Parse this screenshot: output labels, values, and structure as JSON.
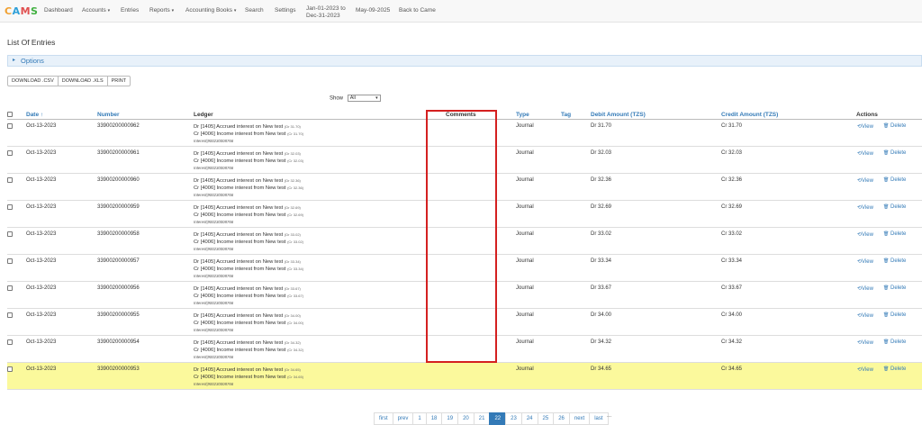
{
  "nav": {
    "logo": [
      "C",
      "A",
      "M",
      "S"
    ],
    "dashboard": "Dashboard",
    "accounts": "Accounts",
    "entries": "Entries",
    "reports": "Reports",
    "accounting_books": "Accounting Books",
    "search": "Search",
    "settings": "Settings",
    "period_line1": "Jan-01-2023 to",
    "period_line2": "Dec-31-2023",
    "date": "May-09-2025",
    "back": "Back to Came",
    "caret": "▾"
  },
  "page_title": "List Of Entries",
  "options": {
    "arrow": "▸",
    "label": "Options"
  },
  "buttons": {
    "csv": "DOWNLOAD .CSV",
    "xls": "DOWNLOAD .XLS",
    "print": "PRINT"
  },
  "show": {
    "label": "Show",
    "value": "All",
    "arrow": "▾"
  },
  "columns": {
    "date": "Date ↑",
    "number": "Number",
    "ledger": "Ledger",
    "comments": "Comments",
    "type": "Type",
    "tag": "Tag",
    "debit": "Debit Amount (TZS)",
    "credit": "Credit Amount (TZS)",
    "actions": "Actions"
  },
  "actions": {
    "view": "View",
    "delete": "Delete",
    "view_icon": "⟲",
    "delete_icon": "🗑"
  },
  "rows": [
    {
      "date": "Oct-13-2023",
      "number": "33900200000962",
      "dr_line": "Dr [1405] Accrued interest on New test",
      "dr_amt": "(Dr 31.70)",
      "cr_line": "Cr [4006] Income interest from New test",
      "cr_amt": "(Cr 31.70)",
      "narration": "Interest|900230008766",
      "type": "Journal",
      "debit": "Dr 31.70",
      "credit": "Cr 31.70"
    },
    {
      "date": "Oct-13-2023",
      "number": "33900200000961",
      "dr_line": "Dr [1405] Accrued interest on New test",
      "dr_amt": "(Dr 32.03)",
      "cr_line": "Cr [4006] Income interest from New test",
      "cr_amt": "(Cr 32.03)",
      "narration": "Interest|900230008766",
      "type": "Journal",
      "debit": "Dr 32.03",
      "credit": "Cr 32.03"
    },
    {
      "date": "Oct-13-2023",
      "number": "33900200000960",
      "dr_line": "Dr [1405] Accrued interest on New test",
      "dr_amt": "(Dr 32.36)",
      "cr_line": "Cr [4006] Income interest from New test",
      "cr_amt": "(Cr 32.36)",
      "narration": "Interest|900230008766",
      "type": "Journal",
      "debit": "Dr 32.36",
      "credit": "Cr 32.36"
    },
    {
      "date": "Oct-13-2023",
      "number": "33900200000959",
      "dr_line": "Dr [1405] Accrued interest on New test",
      "dr_amt": "(Dr 32.69)",
      "cr_line": "Cr [4006] Income interest from New test",
      "cr_amt": "(Cr 32.69)",
      "narration": "Interest|900230008766",
      "type": "Journal",
      "debit": "Dr 32.69",
      "credit": "Cr 32.69"
    },
    {
      "date": "Oct-13-2023",
      "number": "33900200000958",
      "dr_line": "Dr [1405] Accrued interest on New test",
      "dr_amt": "(Dr 33.02)",
      "cr_line": "Cr [4006] Income interest from New test",
      "cr_amt": "(Cr 33.02)",
      "narration": "Interest|900230008766",
      "type": "Journal",
      "debit": "Dr 33.02",
      "credit": "Cr 33.02"
    },
    {
      "date": "Oct-13-2023",
      "number": "33900200000957",
      "dr_line": "Dr [1405] Accrued interest on New test",
      "dr_amt": "(Dr 33.34)",
      "cr_line": "Cr [4006] Income interest from New test",
      "cr_amt": "(Cr 33.34)",
      "narration": "Interest|900230008766",
      "type": "Journal",
      "debit": "Dr 33.34",
      "credit": "Cr 33.34"
    },
    {
      "date": "Oct-13-2023",
      "number": "33900200000956",
      "dr_line": "Dr [1405] Accrued interest on New test",
      "dr_amt": "(Dr 33.67)",
      "cr_line": "Cr [4006] Income interest from New test",
      "cr_amt": "(Cr 33.67)",
      "narration": "Interest|900230008766",
      "type": "Journal",
      "debit": "Dr 33.67",
      "credit": "Cr 33.67"
    },
    {
      "date": "Oct-13-2023",
      "number": "33900200000955",
      "dr_line": "Dr [1405] Accrued interest on New test",
      "dr_amt": "(Dr 34.00)",
      "cr_line": "Cr [4006] Income interest from New test",
      "cr_amt": "(Cr 34.00)",
      "narration": "Interest|900230008766",
      "type": "Journal",
      "debit": "Dr 34.00",
      "credit": "Cr 34.00"
    },
    {
      "date": "Oct-13-2023",
      "number": "33900200000954",
      "dr_line": "Dr [1405] Accrued interest on New test",
      "dr_amt": "(Dr 34.32)",
      "cr_line": "Cr [4006] Income interest from New test",
      "cr_amt": "(Cr 34.32)",
      "narration": "Interest|900230008766",
      "type": "Journal",
      "debit": "Dr 34.32",
      "credit": "Cr 34.32"
    },
    {
      "date": "Oct-13-2023",
      "number": "33900200000953",
      "dr_line": "Dr [1405] Accrued interest on New test",
      "dr_amt": "(Dr 34.65)",
      "cr_line": "Cr [4006] Income interest from New test",
      "cr_amt": "(Cr 34.65)",
      "narration": "Interest|900230008766",
      "type": "Journal",
      "debit": "Dr 34.65",
      "credit": "Cr 34.65"
    }
  ],
  "pagination": {
    "pages": [
      "first",
      "prev",
      "1",
      "18",
      "19",
      "20",
      "21",
      "22",
      "23",
      "24",
      "25",
      "26",
      "next",
      "last"
    ],
    "active": "22",
    "more": "..."
  },
  "colors": {
    "link": "#337ab7",
    "highlight": "#fbf99c",
    "annotation": "#d42020"
  }
}
